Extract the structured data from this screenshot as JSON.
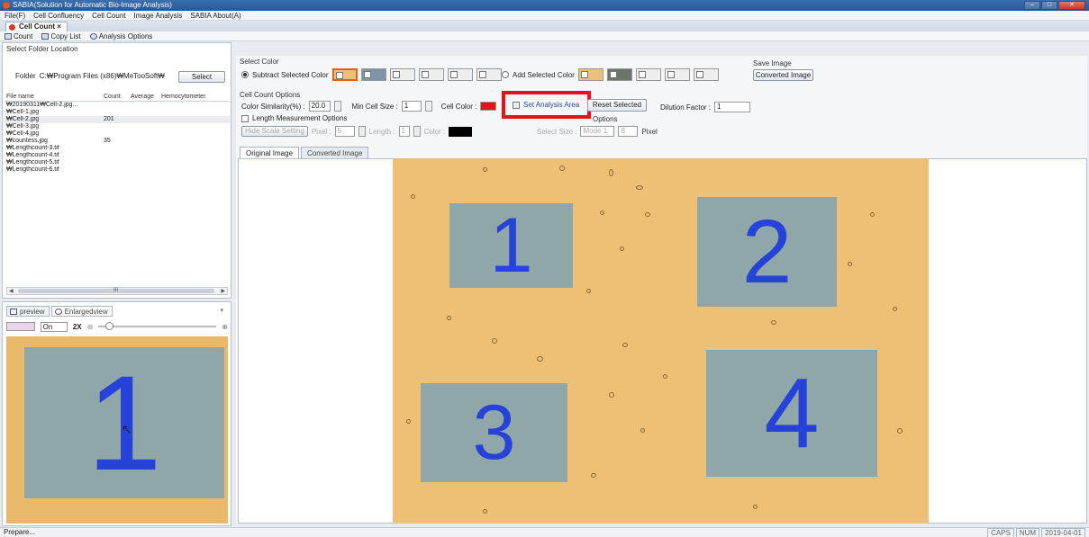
{
  "window": {
    "title": "SABIA(Solution for Automatic Bio-Image Analysis)"
  },
  "menu": [
    "File(F)",
    "Cell Confluency",
    "Cell Count",
    "Image Analysis",
    "SABIA About(A)"
  ],
  "doc_tab": {
    "label": "Cell Count ×"
  },
  "toolbar": {
    "count": "Count",
    "copy_list": "Copy List",
    "analysis_options": "Analysis Options"
  },
  "left": {
    "select_folder_label": "Select Folder Location",
    "folder_label": "Folder",
    "folder_path": "C:₩Program Files (x86)₩MeTooSoft₩",
    "select_button": "Select",
    "columns": [
      "File name",
      "Count",
      "Average",
      "Hemocytometer"
    ],
    "files": [
      {
        "name": "₩20190311₩Cell-2.jpg...",
        "count": ""
      },
      {
        "name": "₩Cell-1.jpg",
        "count": ""
      },
      {
        "name": "₩Cell-2.jpg",
        "count": "201"
      },
      {
        "name": "₩Cell-3.jpg",
        "count": ""
      },
      {
        "name": "₩Cell-4.jpg",
        "count": ""
      },
      {
        "name": "₩countess.jpg",
        "count": "35"
      },
      {
        "name": "₩Lengthcount-3.tif",
        "count": ""
      },
      {
        "name": "₩Lengthcount-4.tif",
        "count": ""
      },
      {
        "name": "₩Lengthcount-5.tif",
        "count": ""
      },
      {
        "name": "₩Lengthcount-6.tif",
        "count": ""
      }
    ],
    "scroll_marker": "III"
  },
  "preview": {
    "tab_preview": "preview",
    "tab_enlarged": "Enlargedview",
    "on_label": "On",
    "zoom": "2X",
    "region_number": "1"
  },
  "options": {
    "select_color": "Select Color",
    "subtract_selected_color": "Subtract Selected Color",
    "add_selected_color": "Add Selected Color",
    "save_image": "Save Image",
    "converted_image_button": "Converted Image",
    "cell_count_options": "Cell Count Options",
    "color_similarity_label": "Color Similarity(%) :",
    "color_similarity_value": "20.0",
    "min_cell_size_label": "Min Cell Size :",
    "min_cell_size_value": "1",
    "cell_color_label": "Cell Color :",
    "cell_color": "#e8101a",
    "set_analysis_area": "Set Analysis Area",
    "reset_selected": "Reset Selected",
    "dilution_factor_label": "Dilution Factor :",
    "dilution_factor_value": "1",
    "length_measurement": "Length Measurement Options",
    "hide_scale_setting": "Hide Scale Setting",
    "pixel_label": "Pixel :",
    "pixel_value": "5",
    "length_label": "Length :",
    "length_value": "1",
    "color_label": "Color :",
    "aggregation_options_partial": "Options",
    "select_size_label": "Select Size :",
    "mode_value": "Mode 1",
    "size_value": "8",
    "pixel_unit": "Pixel"
  },
  "image_tabs": {
    "original": "Original Image",
    "converted": "Converted Image"
  },
  "regions": [
    "1",
    "2",
    "3",
    "4"
  ],
  "status": {
    "left": "Prepare...",
    "caps": "CAPS",
    "num": "NUM",
    "date": "2019-04-01"
  },
  "colors": {
    "image_background": "#edc076",
    "region_fill": "#8fa7a9",
    "region_number": "#2742d8",
    "highlight_box": "#e8101a"
  }
}
